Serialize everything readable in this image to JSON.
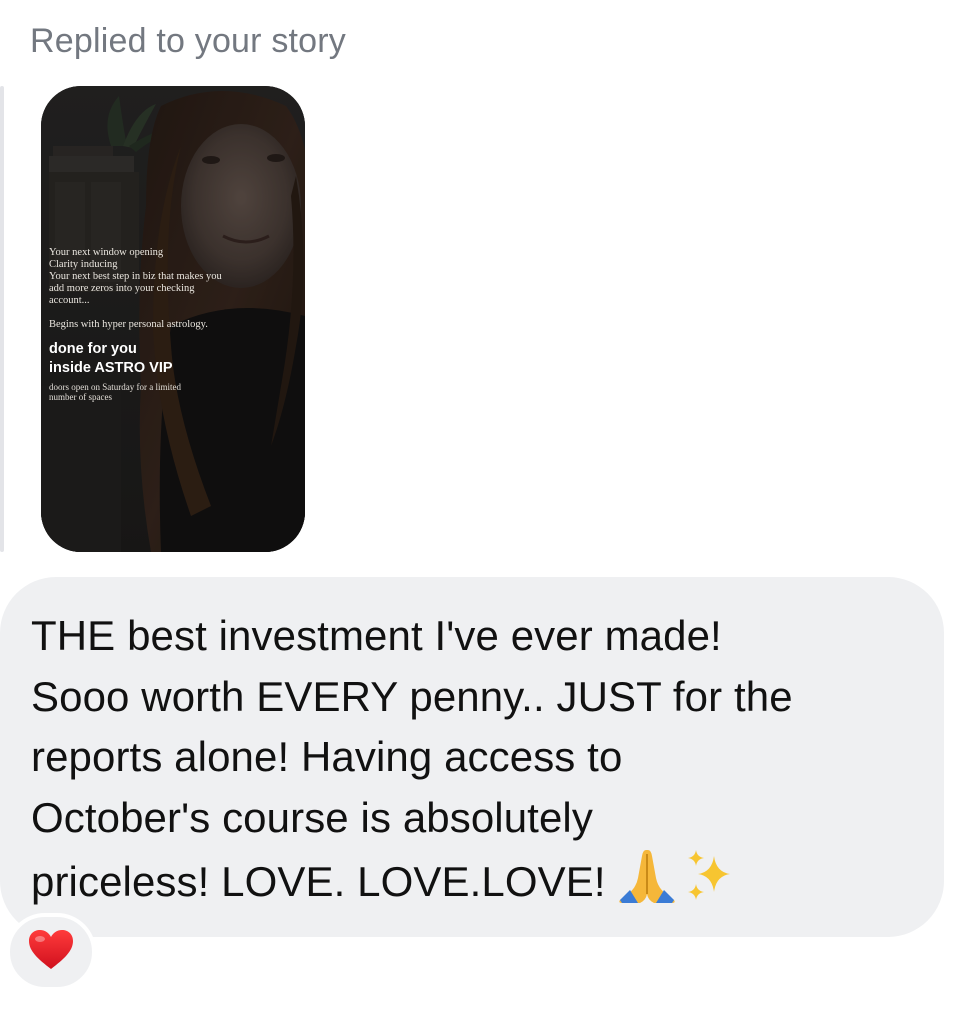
{
  "reply_context": {
    "label": "Replied to your story"
  },
  "story": {
    "lines_serif": [
      "Your next window opening",
      "Clarity inducing",
      "Your next best step in biz that makes you",
      "add more zeros into your checking",
      "account..."
    ],
    "line_astrology": "Begins with hyper personal astrology.",
    "bold_lines": [
      "done for you",
      "inside ASTRO VIP"
    ],
    "small_lines": [
      "doors open on Saturday for a limited",
      "number of spaces"
    ]
  },
  "message": {
    "lines": [
      "THE best investment I've ever made!",
      "Sooo worth EVERY penny.. JUST for the",
      "reports alone! Having access to",
      "October's course is absolutely",
      "priceless! LOVE. LOVE.LOVE!"
    ],
    "emojis": [
      "praying-hands-icon",
      "sparkles-icon"
    ]
  },
  "reaction": {
    "emoji": "red-heart-icon",
    "color": "#e0202e"
  },
  "colors": {
    "bubble": "#eff0f2",
    "label_gray": "#737880",
    "text": "#111111"
  }
}
